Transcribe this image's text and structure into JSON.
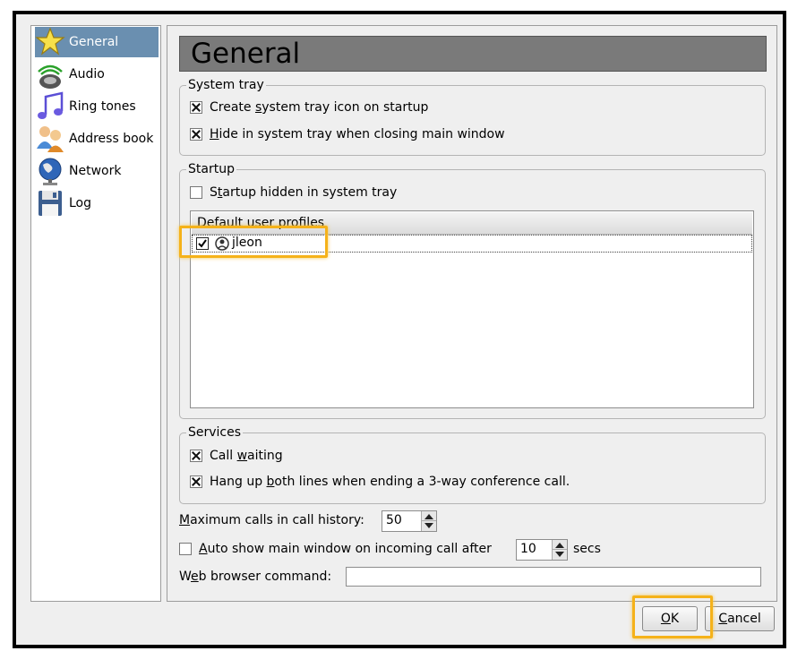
{
  "sidebar": {
    "items": [
      {
        "label": "General",
        "icon": "star-icon",
        "selected": true
      },
      {
        "label": "Audio",
        "icon": "speaker-icon",
        "selected": false
      },
      {
        "label": "Ring tones",
        "icon": "music-note-icon",
        "selected": false
      },
      {
        "label": "Address book",
        "icon": "people-icon",
        "selected": false
      },
      {
        "label": "Network",
        "icon": "globe-network-icon",
        "selected": false
      },
      {
        "label": "Log",
        "icon": "floppy-disk-icon",
        "selected": false
      }
    ]
  },
  "main": {
    "title": "General",
    "system_tray": {
      "title": "System tray",
      "create_icon": {
        "pre": "Create ",
        "mn": "s",
        "post": "ystem tray icon on startup",
        "checked": true
      },
      "hide_on_close": {
        "pre": "",
        "mn": "H",
        "post": "ide in system tray when closing main window",
        "checked": true
      }
    },
    "startup": {
      "title": "Startup",
      "startup_hidden": {
        "pre": "S",
        "mn": "t",
        "post": "artup hidden in system tray",
        "checked": false
      },
      "profiles_header": "Default user profiles",
      "profiles": [
        {
          "name": "jleon",
          "checked": true,
          "icon": "user-profile-icon"
        }
      ]
    },
    "services": {
      "title": "Services",
      "call_waiting": {
        "pre": "Call ",
        "mn": "w",
        "post": "aiting",
        "checked": true
      },
      "hang_up": {
        "pre": "Hang up ",
        "mn": "b",
        "post": "oth lines when ending a 3-way conference call.",
        "checked": true
      }
    },
    "max_calls": {
      "pre": "",
      "mn": "M",
      "post": "aximum calls in call history:",
      "value": "50"
    },
    "auto_show": {
      "pre": "",
      "mn": "A",
      "post": "uto show main window on incoming call after",
      "value": "10",
      "suffix": "secs",
      "checked": false
    },
    "web_browser": {
      "pre": "W",
      "mn": "e",
      "post": "b browser command:",
      "value": ""
    }
  },
  "buttons": {
    "ok": {
      "pre": "",
      "mn": "O",
      "post": "K"
    },
    "cancel": {
      "pre": "",
      "mn": "C",
      "post": "ancel"
    }
  },
  "highlight_color": "#f5b21a"
}
